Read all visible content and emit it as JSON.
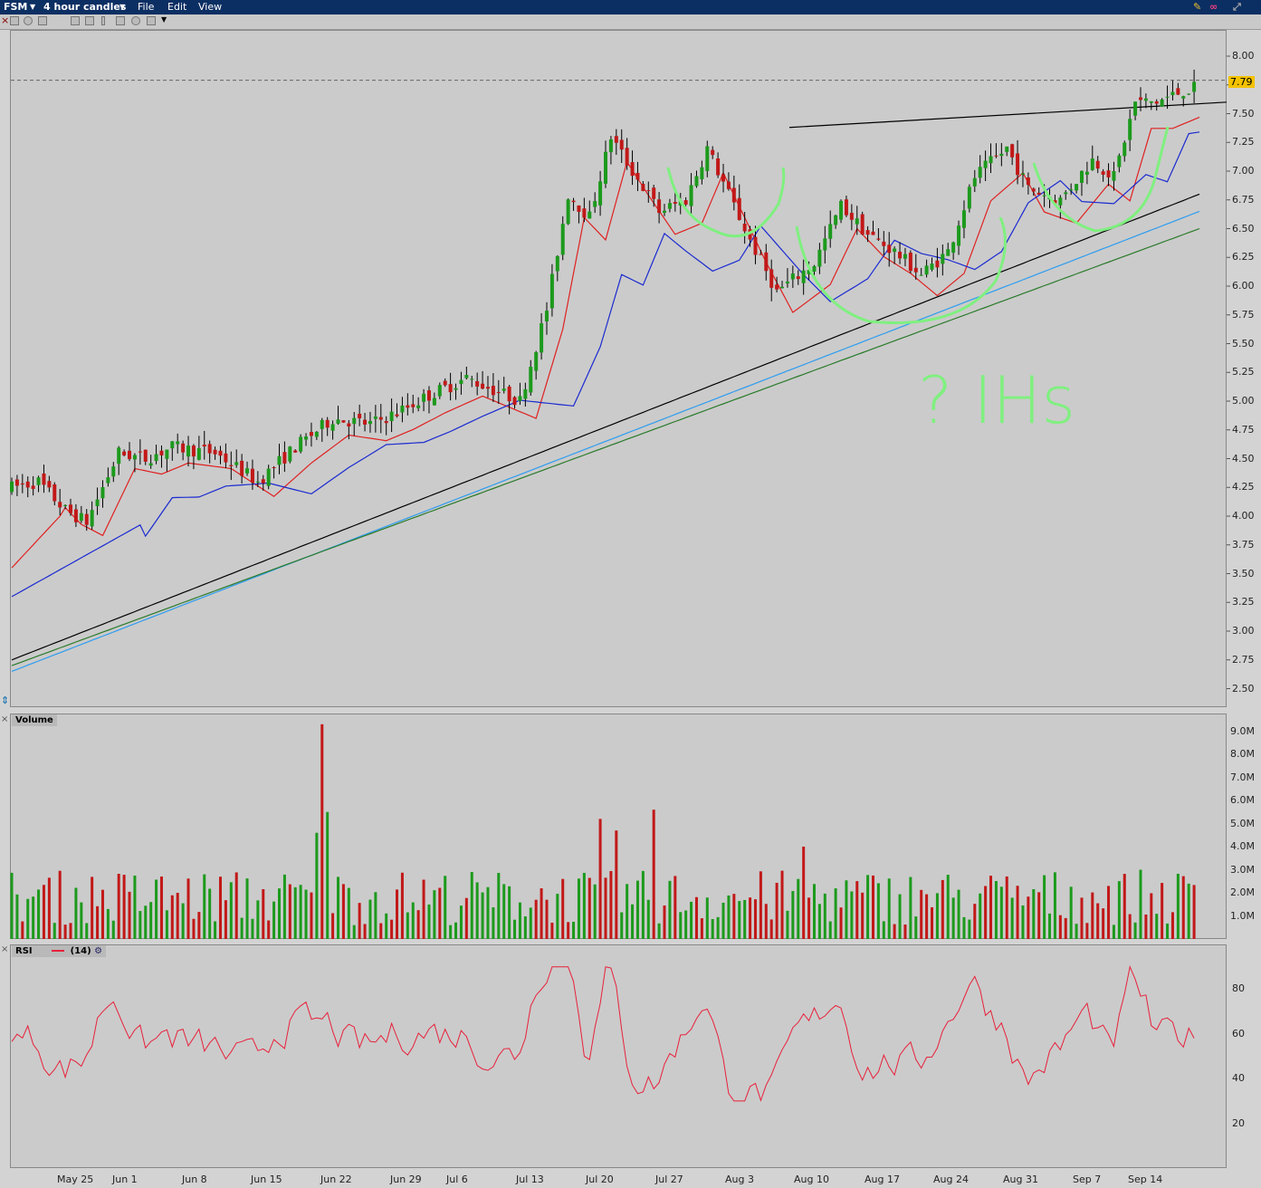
{
  "app": {
    "symbol": "FSM",
    "timeframe": "4 hour candles",
    "menu": [
      "File",
      "Edit",
      "View"
    ]
  },
  "icons": [
    "x-close-icon",
    "crosshair-icon",
    "target-icon",
    "cycle-icon",
    "grid-icon",
    "zoom-icon",
    "bar-icon",
    "refresh-icon",
    "wrench-icon",
    "link-icon",
    "maximize-icon"
  ],
  "colors": {
    "up": "#1c9a1c",
    "down": "#c21818",
    "ma_red": "#e02020",
    "ma_blue": "#1a2ad0",
    "ma_black": "#000000",
    "ma_lightblue": "#2c9cf0",
    "ma_green": "#2a7a2a",
    "rsi": "#e8203a",
    "annotation": "#7ff07f"
  },
  "price_panel": {
    "last_price": "7.79",
    "y_ticks": [
      "8.00",
      "7.75",
      "7.50",
      "7.25",
      "7.00",
      "6.75",
      "6.50",
      "6.25",
      "6.00",
      "5.75",
      "5.50",
      "5.25",
      "5.00",
      "4.75",
      "4.50",
      "4.25",
      "4.00",
      "3.75",
      "3.50",
      "3.25",
      "3.00",
      "2.75",
      "2.50"
    ],
    "annotation_text": "? IHs"
  },
  "volume_panel": {
    "label": "Volume",
    "y_ticks": [
      "9.0M",
      "8.0M",
      "7.0M",
      "6.0M",
      "5.0M",
      "4.0M",
      "3.0M",
      "2.0M",
      "1.0M"
    ]
  },
  "rsi_panel": {
    "label": "RSI",
    "param": "(14)",
    "y_ticks": [
      "80",
      "60",
      "40",
      "20"
    ]
  },
  "x_axis": [
    "May 25",
    "Jun 1",
    "Jun 8",
    "Jun 15",
    "Jun 22",
    "Jun 29",
    "Jul 6",
    "Jul 13",
    "Jul 20",
    "Jul 27",
    "Aug 3",
    "Aug 10",
    "Aug 17",
    "Aug 24",
    "Aug 31",
    "Sep 7",
    "Sep 14"
  ],
  "chart_data": {
    "type": "candlestick",
    "title": "FSM",
    "ylim": [
      2.4,
      8.2
    ],
    "price_path": [
      [
        0,
        4.25
      ],
      [
        5,
        4.3
      ],
      [
        10,
        4.05
      ],
      [
        14,
        3.95
      ],
      [
        20,
        4.55
      ],
      [
        25,
        4.5
      ],
      [
        30,
        4.6
      ],
      [
        38,
        4.55
      ],
      [
        46,
        4.3
      ],
      [
        53,
        4.6
      ],
      [
        60,
        4.85
      ],
      [
        67,
        4.8
      ],
      [
        72,
        4.9
      ],
      [
        78,
        5.05
      ],
      [
        85,
        5.2
      ],
      [
        90,
        5.1
      ],
      [
        95,
        5.0
      ],
      [
        100,
        5.8
      ],
      [
        104,
        6.8
      ],
      [
        108,
        6.6
      ],
      [
        112,
        7.3
      ],
      [
        116,
        7.0
      ],
      [
        121,
        6.65
      ],
      [
        126,
        6.75
      ],
      [
        130,
        7.2
      ],
      [
        134,
        6.8
      ],
      [
        138,
        6.4
      ],
      [
        143,
        5.95
      ],
      [
        150,
        6.2
      ],
      [
        155,
        6.7
      ],
      [
        160,
        6.45
      ],
      [
        165,
        6.3
      ],
      [
        170,
        6.1
      ],
      [
        175,
        6.3
      ],
      [
        180,
        6.95
      ],
      [
        186,
        7.2
      ],
      [
        190,
        6.85
      ],
      [
        196,
        6.75
      ],
      [
        202,
        7.1
      ],
      [
        206,
        6.95
      ],
      [
        210,
        7.6
      ],
      [
        214,
        7.6
      ],
      [
        219,
        7.7
      ],
      [
        221,
        7.72
      ]
    ],
    "ma_periods": [
      {
        "color": "red",
        "start": 3.55,
        "end": 7.5
      },
      {
        "color": "blue",
        "start": 3.3,
        "end": 7.2
      },
      {
        "color": "black",
        "start": 2.75,
        "end": 6.8
      },
      {
        "color": "lightblue",
        "start": 2.65,
        "end": 6.65
      },
      {
        "color": "green",
        "start": 2.7,
        "end": 6.5
      }
    ],
    "volume_ylim": [
      0,
      9.5
    ],
    "rsi_ylim": [
      0,
      100
    ]
  }
}
